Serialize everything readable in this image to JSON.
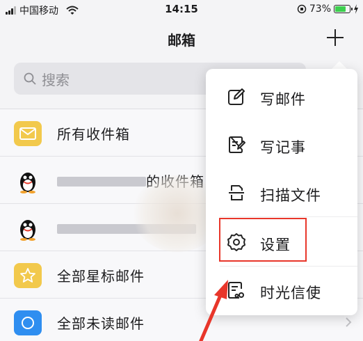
{
  "status_bar": {
    "carrier": "中国移动",
    "time": "14:15",
    "battery_percent": "73%",
    "battery_level": 0.73
  },
  "nav": {
    "title": "邮箱"
  },
  "search": {
    "placeholder": "搜索"
  },
  "mailbox_list": [
    {
      "label": "所有收件箱",
      "icon": "envelope-icon"
    },
    {
      "label": "的收件箱",
      "icon": "qq-penguin-icon"
    },
    {
      "label": "",
      "icon": "qq-penguin-icon"
    },
    {
      "label": "全部星标邮件",
      "icon": "star-icon"
    },
    {
      "label": "全部未读邮件",
      "icon": "unread-circle-icon"
    }
  ],
  "popup_menu": [
    {
      "label": "写邮件",
      "icon": "compose-icon"
    },
    {
      "label": "写记事",
      "icon": "note-icon"
    },
    {
      "label": "扫描文件",
      "icon": "scan-icon"
    },
    {
      "label": "设置",
      "icon": "gear-icon"
    },
    {
      "label": "时光信使",
      "icon": "time-letter-icon"
    }
  ],
  "colors": {
    "accent_yellow": "#f2c94c",
    "accent_blue": "#2f8ef0",
    "highlight_red": "#e8362a",
    "battery_green": "#3ccf4e"
  }
}
